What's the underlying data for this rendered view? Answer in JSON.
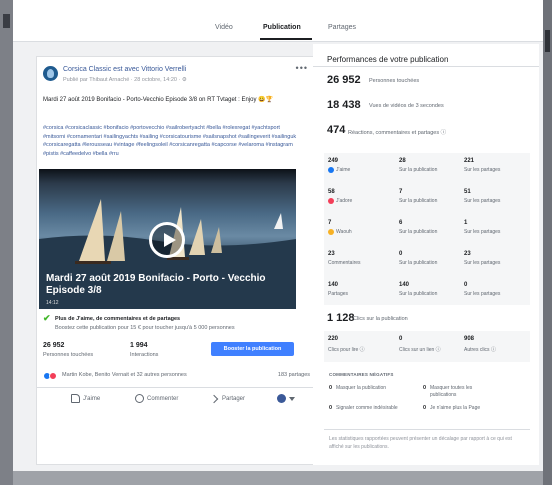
{
  "tabs": [
    {
      "label": "Vidéo"
    },
    {
      "label": "Publication"
    },
    {
      "label": "Partages"
    }
  ],
  "post": {
    "page_name": "Corsica Classic est avec Vittorio Verrelli",
    "meta": "Publié par Thibaut Arnaché · 28 octobre, 14:20 · ⚙",
    "text": "Mardi 27 août 2019 Bonifacio - Porto-Vecchio Episode 3/8 on RT Tvtaget : Enjoy 😀🏆",
    "hashtags": "#corsica #corsicaclassic #bonifacio #portovecchio #sailrobertyacht #bella #rolexregat #yachtsport #mitsorni #cornamentari #sailingyachts #sailing #corsicatourisme #sailsnapshot #sailingeverit #sailinguk #corsicaregatta #lerousseau #vintage #feelingsoleil #corsicanregatta #capcorse #velaroma #instagram #pistis #caffeedelvo #bella #rru",
    "video_title": "Mardi 27 août 2019 Bonifacio - Porto - Vecchio Episode 3/8",
    "video_time": "14:12",
    "promo_title": "Plus de J'aime, de commentaires et de partages",
    "promo_sub": "Boostez cette publication pour 15 € pour toucher jusqu'à 5 000 personnes",
    "reach_num": "26 952",
    "reach_label": "Personnes touchées",
    "interactions_num": "1 994",
    "interactions_label": "Interactions",
    "boost_label": "Booster la publication",
    "reactions_names": "Martin Kobe, Benito Vernait et 32 autres personnes",
    "shares_count": "183 partages",
    "actions": {
      "like": "J'aime",
      "comment": "Commenter",
      "share": "Partager"
    }
  },
  "perf": {
    "title": "Performances de votre publication",
    "reach_num": "26 952",
    "reach_label": "Personnes touchées",
    "views_num": "18 438",
    "views_label": "Vues de vidéos de 3 secondes",
    "reactions_num": "474",
    "reactions_label": "Réactions, commentaires et partages ⓘ",
    "rows": [
      {
        "total": "249",
        "name": "J'aime",
        "post": "28",
        "post_label": "Sur la publication",
        "shares": "221",
        "shares_label": "Sur les partages",
        "icon_color": "#1877f2"
      },
      {
        "total": "58",
        "name": "J'adore",
        "post": "7",
        "post_label": "Sur la publication",
        "shares": "51",
        "shares_label": "Sur les partages",
        "icon_color": "#f33e58"
      },
      {
        "total": "7",
        "name": "Waouh",
        "post": "6",
        "post_label": "Sur la publication",
        "shares": "1",
        "shares_label": "Sur les partages",
        "icon_color": "#f7b125"
      },
      {
        "total": "23",
        "name": "Commentaires",
        "post": "0",
        "post_label": "Sur la publication",
        "shares": "23",
        "shares_label": "Sur les partages",
        "icon_color": ""
      },
      {
        "total": "140",
        "name": "Partages",
        "post": "140",
        "post_label": "Sur la publication",
        "shares": "0",
        "shares_label": "Sur les partages",
        "icon_color": ""
      }
    ],
    "clicks_num": "1 128",
    "clicks_label": "Clics sur la publication",
    "click_types": [
      {
        "num": "220",
        "label": "Clics pour lire ⓘ"
      },
      {
        "num": "0",
        "label": "Clics sur un lien ⓘ"
      },
      {
        "num": "908",
        "label": "Autres clics ⓘ"
      }
    ],
    "negative_title": "COMMENTAIRES NÉGATIFS",
    "negative": [
      {
        "num": "0",
        "label": "Masquer la publication"
      },
      {
        "num": "0",
        "label": "Masquer toutes les publications"
      },
      {
        "num": "0",
        "label": "Signaler comme indésirable"
      },
      {
        "num": "0",
        "label": "Je n'aime plus la Page"
      }
    ],
    "note": "Les statistiques rapportées peuvent présenter un décalage par rapport à ce qui est affiché sur les publications."
  }
}
